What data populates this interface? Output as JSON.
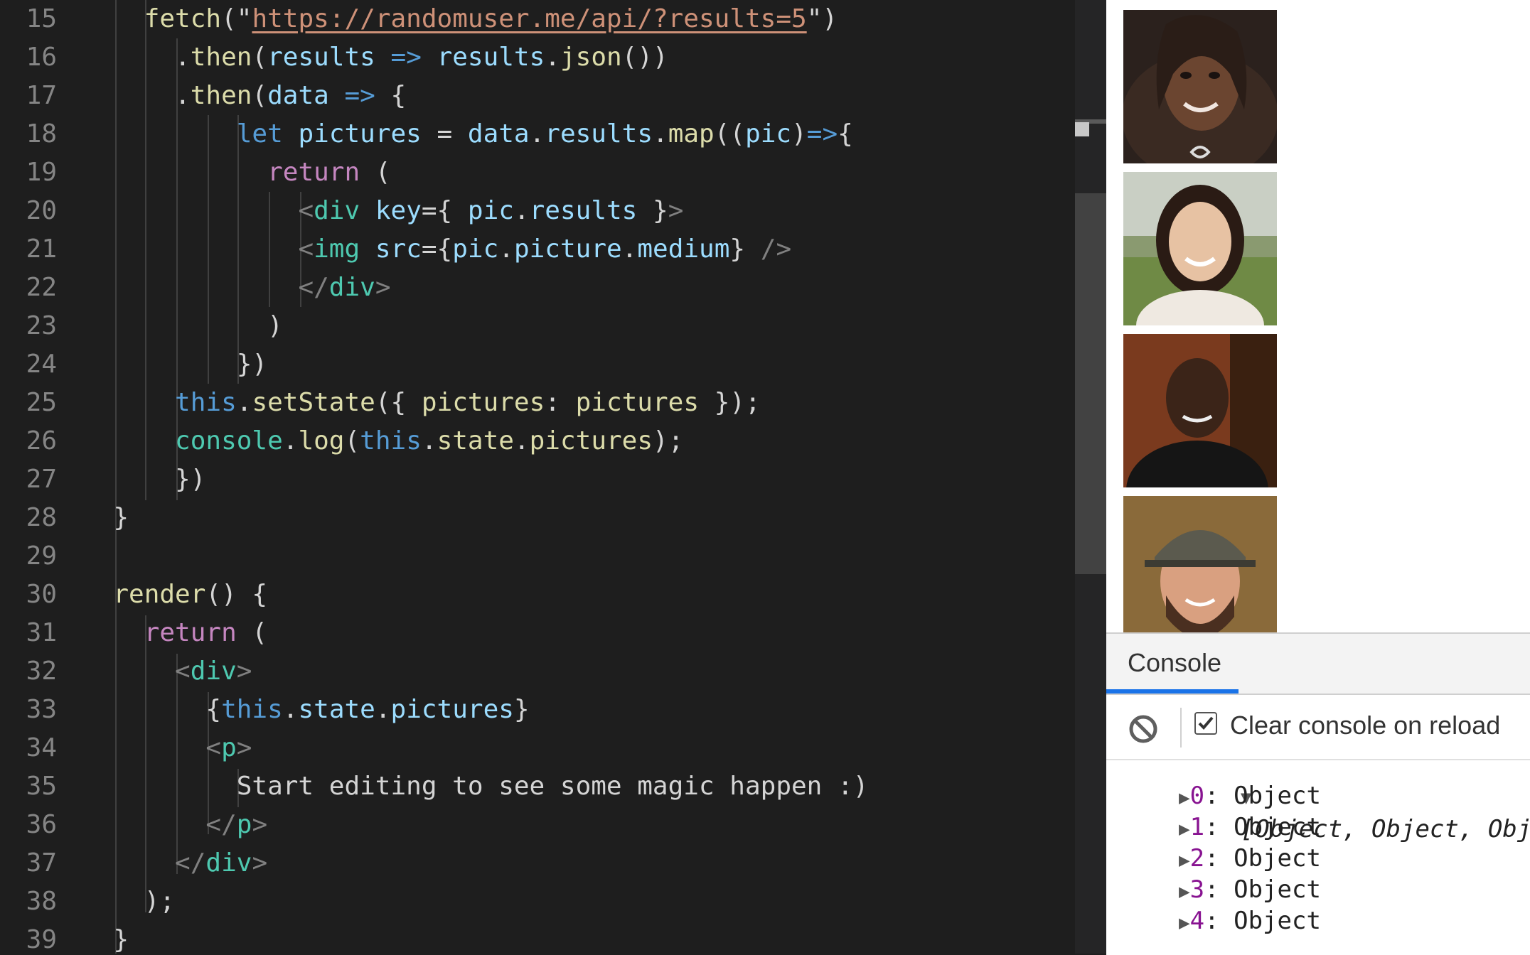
{
  "editor": {
    "line_numbers": [
      "15",
      "16",
      "17",
      "18",
      "19",
      "20",
      "21",
      "22",
      "23",
      "24",
      "25",
      "26",
      "27",
      "28",
      "29",
      "30",
      "31",
      "32",
      "33",
      "34",
      "35",
      "36",
      "37",
      "38",
      "39"
    ],
    "lines": [
      [
        [
          "    ",
          "p"
        ],
        [
          "fetch",
          "fn"
        ],
        [
          "(\"",
          "p"
        ],
        [
          "https://randomuser.me/api/?results=5",
          "stru"
        ],
        [
          "\")",
          "p"
        ]
      ],
      [
        [
          "      .",
          "p"
        ],
        [
          "then",
          "fn"
        ],
        [
          "(",
          "p"
        ],
        [
          "results",
          "var"
        ],
        [
          " ",
          "p"
        ],
        [
          "=>",
          "kw"
        ],
        [
          " ",
          "p"
        ],
        [
          "results",
          "var"
        ],
        [
          ".",
          "p"
        ],
        [
          "json",
          "fn"
        ],
        [
          "())",
          "p"
        ]
      ],
      [
        [
          "      .",
          "p"
        ],
        [
          "then",
          "fn"
        ],
        [
          "(",
          "p"
        ],
        [
          "data",
          "var"
        ],
        [
          " ",
          "p"
        ],
        [
          "=>",
          "kw"
        ],
        [
          " {",
          "p"
        ]
      ],
      [
        [
          "          ",
          "p"
        ],
        [
          "let",
          "kw"
        ],
        [
          " ",
          "p"
        ],
        [
          "pictures",
          "var"
        ],
        [
          " = ",
          "p"
        ],
        [
          "data",
          "var"
        ],
        [
          ".",
          "p"
        ],
        [
          "results",
          "var"
        ],
        [
          ".",
          "p"
        ],
        [
          "map",
          "fn"
        ],
        [
          "((",
          "p"
        ],
        [
          "pic",
          "var"
        ],
        [
          ")",
          "p"
        ],
        [
          "=>",
          "kw"
        ],
        [
          "{",
          "p"
        ]
      ],
      [
        [
          "            ",
          "p"
        ],
        [
          "return",
          "ctl"
        ],
        [
          " (",
          "p"
        ]
      ],
      [
        [
          "              ",
          "p"
        ],
        [
          "<",
          "br"
        ],
        [
          "div",
          "tag"
        ],
        [
          " ",
          "p"
        ],
        [
          "key",
          "var"
        ],
        [
          "={ ",
          "p"
        ],
        [
          "pic",
          "var"
        ],
        [
          ".",
          "p"
        ],
        [
          "results",
          "var"
        ],
        [
          " }",
          "p"
        ],
        [
          ">",
          "br"
        ]
      ],
      [
        [
          "              ",
          "p"
        ],
        [
          "<",
          "br"
        ],
        [
          "img",
          "tag"
        ],
        [
          " ",
          "p"
        ],
        [
          "src",
          "var"
        ],
        [
          "={",
          "p"
        ],
        [
          "pic",
          "var"
        ],
        [
          ".",
          "p"
        ],
        [
          "picture",
          "var"
        ],
        [
          ".",
          "p"
        ],
        [
          "medium",
          "var"
        ],
        [
          "} ",
          "p"
        ],
        [
          "/>",
          "br"
        ]
      ],
      [
        [
          "              ",
          "p"
        ],
        [
          "</",
          "br"
        ],
        [
          "div",
          "tag"
        ],
        [
          ">",
          "br"
        ]
      ],
      [
        [
          "            )",
          "p"
        ]
      ],
      [
        [
          "          })",
          "p"
        ]
      ],
      [
        [
          "      ",
          "p"
        ],
        [
          "this",
          "kw"
        ],
        [
          ".",
          "p"
        ],
        [
          "setState",
          "fn"
        ],
        [
          "({ ",
          "p"
        ],
        [
          "pictures",
          "fn"
        ],
        [
          ": ",
          "p"
        ],
        [
          "pictures",
          "fn"
        ],
        [
          " });",
          "p"
        ]
      ],
      [
        [
          "      ",
          "p"
        ],
        [
          "console",
          "tag"
        ],
        [
          ".",
          "p"
        ],
        [
          "log",
          "fn"
        ],
        [
          "(",
          "p"
        ],
        [
          "this",
          "kw"
        ],
        [
          ".",
          "p"
        ],
        [
          "state",
          "fn"
        ],
        [
          ".",
          "p"
        ],
        [
          "pictures",
          "fn"
        ],
        [
          ");",
          "p"
        ]
      ],
      [
        [
          "      })",
          "p"
        ]
      ],
      [
        [
          "  }",
          "p"
        ]
      ],
      [
        [
          "",
          "p"
        ]
      ],
      [
        [
          "  ",
          "p"
        ],
        [
          "render",
          "fn"
        ],
        [
          "() {",
          "p"
        ]
      ],
      [
        [
          "    ",
          "p"
        ],
        [
          "return",
          "ctl"
        ],
        [
          " (",
          "p"
        ]
      ],
      [
        [
          "      ",
          "p"
        ],
        [
          "<",
          "br"
        ],
        [
          "div",
          "tag"
        ],
        [
          ">",
          "br"
        ]
      ],
      [
        [
          "        {",
          "p"
        ],
        [
          "this",
          "kw"
        ],
        [
          ".",
          "p"
        ],
        [
          "state",
          "var"
        ],
        [
          ".",
          "p"
        ],
        [
          "pictures",
          "var"
        ],
        [
          "}",
          "p"
        ]
      ],
      [
        [
          "        ",
          "p"
        ],
        [
          "<",
          "br"
        ],
        [
          "p",
          "tag"
        ],
        [
          ">",
          "br"
        ]
      ],
      [
        [
          "          Start editing to see some magic happen :)",
          "p"
        ]
      ],
      [
        [
          "        ",
          "p"
        ],
        [
          "</",
          "br"
        ],
        [
          "p",
          "tag"
        ],
        [
          ">",
          "br"
        ]
      ],
      [
        [
          "      ",
          "p"
        ],
        [
          "</",
          "br"
        ],
        [
          "div",
          "tag"
        ],
        [
          ">",
          "br"
        ]
      ],
      [
        [
          "    );",
          "p"
        ]
      ],
      [
        [
          "  }",
          "p"
        ]
      ]
    ]
  },
  "colors": {
    "fn": "#dcdcaa",
    "str": "#ce9178",
    "var": "#9cdcfe",
    "kw": "#569cd6",
    "ctl": "#c586c0",
    "tag": "#4ec9b0",
    "bracket": "#808080",
    "plain": "#d4d4d4"
  },
  "preview": {
    "avatars": [
      "avatar-woman-curly-hair",
      "avatar-woman-smiling",
      "avatar-man-dark-shirt",
      "avatar-man-cap-beard"
    ]
  },
  "console": {
    "tab_label": "Console",
    "clear_console_label": "Clear console on reload",
    "clear_console_checked": true,
    "array_summary": "[Object, Object, Object,",
    "items": [
      {
        "index": "0",
        "value": "Object"
      },
      {
        "index": "1",
        "value": "Object"
      },
      {
        "index": "2",
        "value": "Object"
      },
      {
        "index": "3",
        "value": "Object"
      },
      {
        "index": "4",
        "value": "Object"
      }
    ]
  }
}
